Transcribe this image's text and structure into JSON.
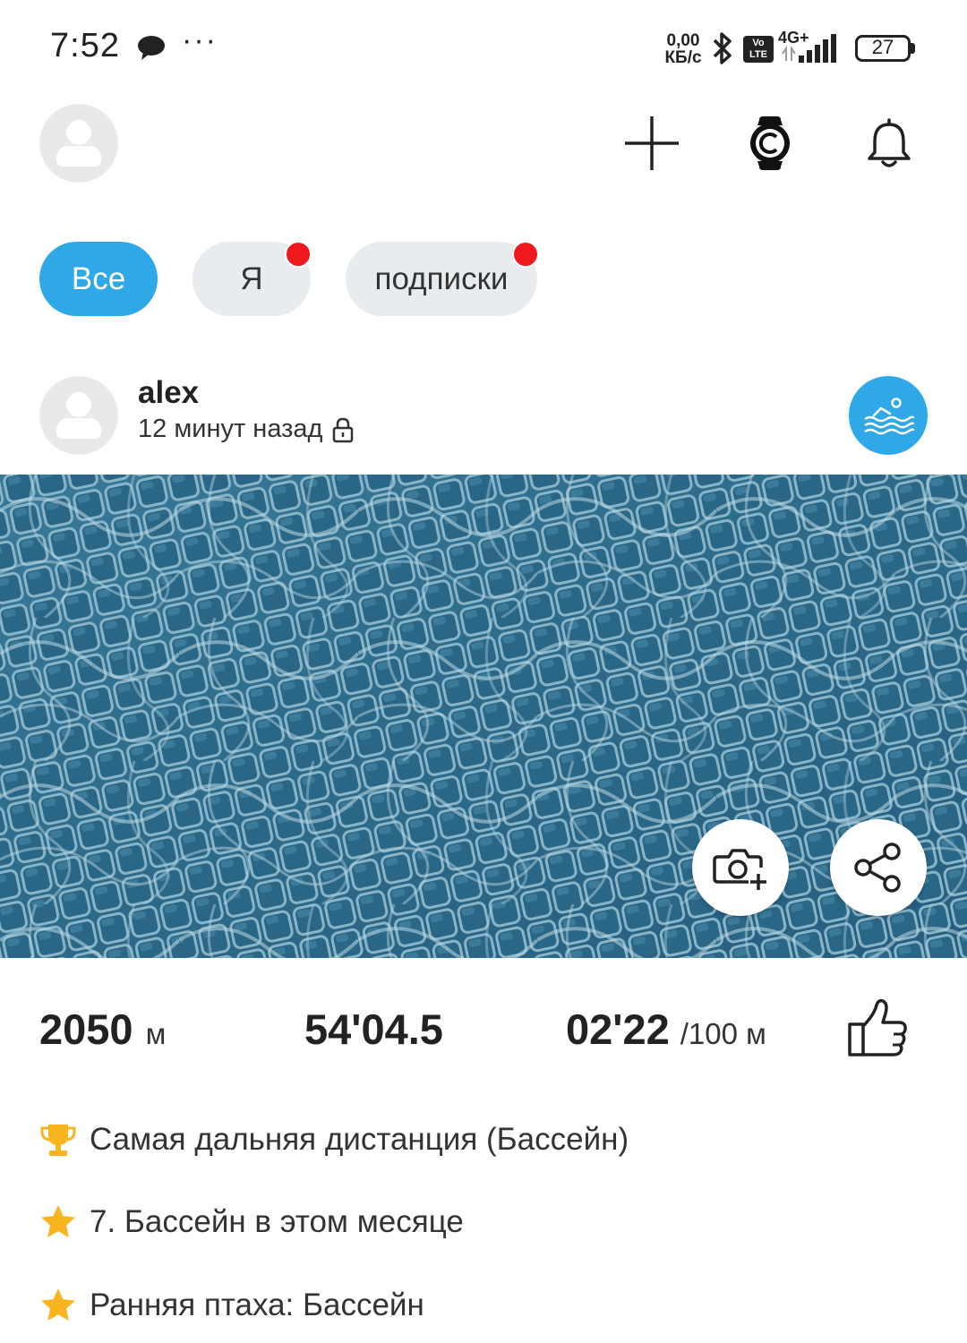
{
  "status_bar": {
    "time": "7:52",
    "more": "···",
    "network_speed_value": "0,00",
    "network_speed_unit": "КБ/с",
    "volte_top": "Vo",
    "volte_bottom": "LTE",
    "network_type": "4G+",
    "battery_level": "27"
  },
  "header": {
    "add_icon": "plus-icon",
    "watch_icon": "watch-icon",
    "notifications_icon": "bell-icon"
  },
  "filters": {
    "items": [
      {
        "label": "Все",
        "active": true,
        "has_dot": false
      },
      {
        "label": "Я",
        "active": false,
        "has_dot": true
      },
      {
        "label": "подписки",
        "active": false,
        "has_dot": true
      }
    ]
  },
  "post": {
    "user_name": "alex",
    "time_ago": "12 минут назад",
    "privacy_icon": "lock-icon",
    "sport_icon": "swimming-icon",
    "photo": "pool-water-photo",
    "stats": {
      "distance_value": "2050",
      "distance_unit": "м",
      "duration_value": "54'04.5",
      "pace_value": "02'22",
      "pace_unit": "/100 м"
    },
    "achievements": [
      {
        "icon": "trophy-icon",
        "text": "Самая дальняя дистанция (Бассейн)"
      },
      {
        "icon": "star-icon",
        "text": "7. Бассейн в этом месяце"
      },
      {
        "icon": "star-icon",
        "text": "Ранняя птаха: Бассейн"
      }
    ]
  },
  "colors": {
    "accent": "#2ea8e6",
    "notification_dot": "#f0181c",
    "chip_background": "#e9ecef",
    "achievement_gold": "#f9b51f"
  }
}
